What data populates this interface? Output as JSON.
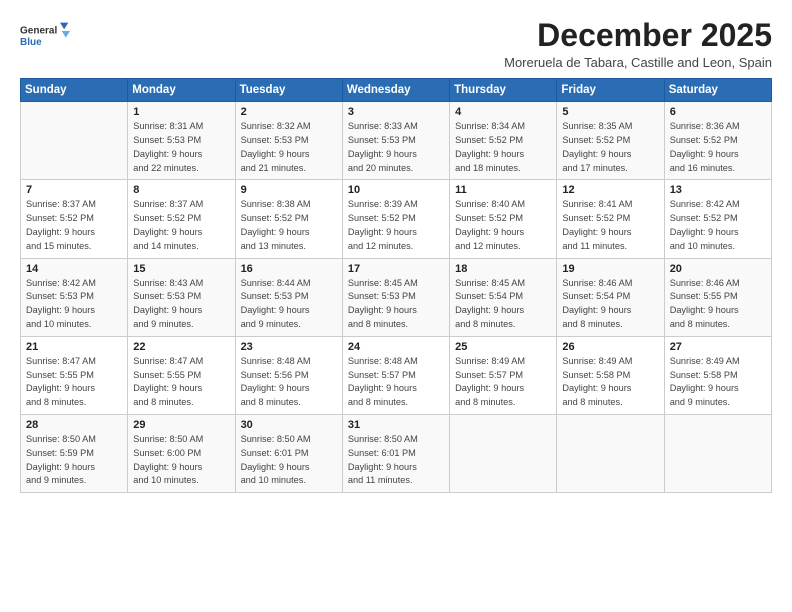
{
  "logo": {
    "line1": "General",
    "line2": "Blue"
  },
  "title": "December 2025",
  "subtitle": "Moreruela de Tabara, Castille and Leon, Spain",
  "days_header": [
    "Sunday",
    "Monday",
    "Tuesday",
    "Wednesday",
    "Thursday",
    "Friday",
    "Saturday"
  ],
  "weeks": [
    [
      {
        "day": "",
        "info": ""
      },
      {
        "day": "1",
        "info": "Sunrise: 8:31 AM\nSunset: 5:53 PM\nDaylight: 9 hours\nand 22 minutes."
      },
      {
        "day": "2",
        "info": "Sunrise: 8:32 AM\nSunset: 5:53 PM\nDaylight: 9 hours\nand 21 minutes."
      },
      {
        "day": "3",
        "info": "Sunrise: 8:33 AM\nSunset: 5:53 PM\nDaylight: 9 hours\nand 20 minutes."
      },
      {
        "day": "4",
        "info": "Sunrise: 8:34 AM\nSunset: 5:52 PM\nDaylight: 9 hours\nand 18 minutes."
      },
      {
        "day": "5",
        "info": "Sunrise: 8:35 AM\nSunset: 5:52 PM\nDaylight: 9 hours\nand 17 minutes."
      },
      {
        "day": "6",
        "info": "Sunrise: 8:36 AM\nSunset: 5:52 PM\nDaylight: 9 hours\nand 16 minutes."
      }
    ],
    [
      {
        "day": "7",
        "info": "Sunrise: 8:37 AM\nSunset: 5:52 PM\nDaylight: 9 hours\nand 15 minutes."
      },
      {
        "day": "8",
        "info": "Sunrise: 8:37 AM\nSunset: 5:52 PM\nDaylight: 9 hours\nand 14 minutes."
      },
      {
        "day": "9",
        "info": "Sunrise: 8:38 AM\nSunset: 5:52 PM\nDaylight: 9 hours\nand 13 minutes."
      },
      {
        "day": "10",
        "info": "Sunrise: 8:39 AM\nSunset: 5:52 PM\nDaylight: 9 hours\nand 12 minutes."
      },
      {
        "day": "11",
        "info": "Sunrise: 8:40 AM\nSunset: 5:52 PM\nDaylight: 9 hours\nand 12 minutes."
      },
      {
        "day": "12",
        "info": "Sunrise: 8:41 AM\nSunset: 5:52 PM\nDaylight: 9 hours\nand 11 minutes."
      },
      {
        "day": "13",
        "info": "Sunrise: 8:42 AM\nSunset: 5:52 PM\nDaylight: 9 hours\nand 10 minutes."
      }
    ],
    [
      {
        "day": "14",
        "info": "Sunrise: 8:42 AM\nSunset: 5:53 PM\nDaylight: 9 hours\nand 10 minutes."
      },
      {
        "day": "15",
        "info": "Sunrise: 8:43 AM\nSunset: 5:53 PM\nDaylight: 9 hours\nand 9 minutes."
      },
      {
        "day": "16",
        "info": "Sunrise: 8:44 AM\nSunset: 5:53 PM\nDaylight: 9 hours\nand 9 minutes."
      },
      {
        "day": "17",
        "info": "Sunrise: 8:45 AM\nSunset: 5:53 PM\nDaylight: 9 hours\nand 8 minutes."
      },
      {
        "day": "18",
        "info": "Sunrise: 8:45 AM\nSunset: 5:54 PM\nDaylight: 9 hours\nand 8 minutes."
      },
      {
        "day": "19",
        "info": "Sunrise: 8:46 AM\nSunset: 5:54 PM\nDaylight: 9 hours\nand 8 minutes."
      },
      {
        "day": "20",
        "info": "Sunrise: 8:46 AM\nSunset: 5:55 PM\nDaylight: 9 hours\nand 8 minutes."
      }
    ],
    [
      {
        "day": "21",
        "info": "Sunrise: 8:47 AM\nSunset: 5:55 PM\nDaylight: 9 hours\nand 8 minutes."
      },
      {
        "day": "22",
        "info": "Sunrise: 8:47 AM\nSunset: 5:55 PM\nDaylight: 9 hours\nand 8 minutes."
      },
      {
        "day": "23",
        "info": "Sunrise: 8:48 AM\nSunset: 5:56 PM\nDaylight: 9 hours\nand 8 minutes."
      },
      {
        "day": "24",
        "info": "Sunrise: 8:48 AM\nSunset: 5:57 PM\nDaylight: 9 hours\nand 8 minutes."
      },
      {
        "day": "25",
        "info": "Sunrise: 8:49 AM\nSunset: 5:57 PM\nDaylight: 9 hours\nand 8 minutes."
      },
      {
        "day": "26",
        "info": "Sunrise: 8:49 AM\nSunset: 5:58 PM\nDaylight: 9 hours\nand 8 minutes."
      },
      {
        "day": "27",
        "info": "Sunrise: 8:49 AM\nSunset: 5:58 PM\nDaylight: 9 hours\nand 9 minutes."
      }
    ],
    [
      {
        "day": "28",
        "info": "Sunrise: 8:50 AM\nSunset: 5:59 PM\nDaylight: 9 hours\nand 9 minutes."
      },
      {
        "day": "29",
        "info": "Sunrise: 8:50 AM\nSunset: 6:00 PM\nDaylight: 9 hours\nand 10 minutes."
      },
      {
        "day": "30",
        "info": "Sunrise: 8:50 AM\nSunset: 6:01 PM\nDaylight: 9 hours\nand 10 minutes."
      },
      {
        "day": "31",
        "info": "Sunrise: 8:50 AM\nSunset: 6:01 PM\nDaylight: 9 hours\nand 11 minutes."
      },
      {
        "day": "",
        "info": ""
      },
      {
        "day": "",
        "info": ""
      },
      {
        "day": "",
        "info": ""
      }
    ]
  ]
}
